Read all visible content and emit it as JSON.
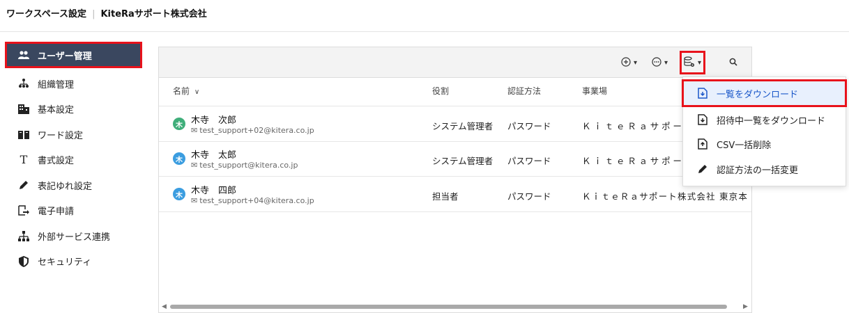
{
  "header": {
    "section": "ワークスペース設定",
    "separator": "|",
    "org": "KiteRaサポート株式会社"
  },
  "sidebar": {
    "items": [
      {
        "label": "ユーザー管理",
        "icon": "users-icon",
        "active": true
      },
      {
        "label": "組織管理",
        "icon": "org-tree-icon"
      },
      {
        "label": "基本設定",
        "icon": "building-icon"
      },
      {
        "label": "ワード設定",
        "icon": "book-icon"
      },
      {
        "label": "書式設定",
        "icon": "text-format-icon"
      },
      {
        "label": "表記ゆれ設定",
        "icon": "pencil-icon"
      },
      {
        "label": "電子申請",
        "icon": "file-send-icon"
      },
      {
        "label": "外部サービス連携",
        "icon": "network-icon"
      },
      {
        "label": "セキュリティ",
        "icon": "shield-icon"
      }
    ]
  },
  "toolbar": {
    "add": {
      "icon": "add-circle-icon",
      "caret": "▾"
    },
    "more": {
      "icon": "more-circle-icon",
      "caret": "▾"
    },
    "export": {
      "icon": "database-settings-icon",
      "caret": "▾"
    },
    "search": {
      "icon": "search-icon"
    }
  },
  "table": {
    "columns": {
      "name": "名前",
      "name_sort": "∨",
      "role": "役割",
      "auth": "認証方法",
      "office": "事業場"
    },
    "rows": [
      {
        "avatar": "木",
        "avatar_color": "#3fae7a",
        "name": "木寺　次郎",
        "email": "test_support+02@kitera.co.jp",
        "role": "システム管理者",
        "auth": "パスワード",
        "office": "ＫｉｔｅＲａサポート株"
      },
      {
        "avatar": "木",
        "avatar_color": "#3b9de0",
        "name": "木寺　太郎",
        "email": "test_support@kitera.co.jp",
        "role": "システム管理者",
        "auth": "パスワード",
        "office": "ＫｉｔｅＲａサポート株"
      },
      {
        "avatar": "木",
        "avatar_color": "#3b9de0",
        "name": "木寺　四郎",
        "email": "test_support+04@kitera.co.jp",
        "role": "担当者",
        "auth": "パスワード",
        "office": "ＫｉｔｅＲａサポート株式会社 東京本"
      }
    ]
  },
  "menu": {
    "items": [
      {
        "label": "一覧をダウンロード",
        "icon": "file-download-icon",
        "highlighted": true
      },
      {
        "label": "招待中一覧をダウンロード",
        "icon": "file-download-icon"
      },
      {
        "label": "CSV一括削除",
        "icon": "file-upload-icon"
      },
      {
        "label": "認証方法の一括変更",
        "icon": "pencil-icon"
      }
    ]
  },
  "colors": {
    "sidebar_active": "#3a475f",
    "highlight_border": "#e8121b",
    "menu_highlight_text": "#1a57c9"
  }
}
